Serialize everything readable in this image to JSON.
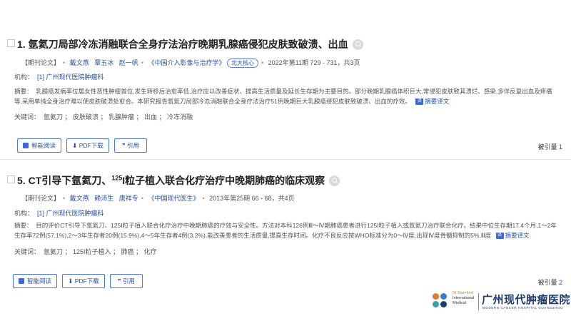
{
  "records": [
    {
      "title_num": "1.",
      "title_text": "氩氦刀局部冷冻消融联合全身疗法治疗晚期乳腺癌侵犯皮肤致破溃、出血",
      "type_label": "【期刊论文】",
      "authors": [
        "戴文燕",
        "覃玉冰",
        "赵一帆"
      ],
      "journal": "《中国介入影像与治疗学》",
      "badge": "北大核心",
      "issue": "2022年第11期 729 - 731，共3页",
      "org_label": "机构：",
      "org_value": "[1] 广州现代医院肿瘤科",
      "abstract_label": "摘要：",
      "abstract": "乳腺癌发病率位居女性恶性肿瘤首位,发生转移后治愈率低,治疗应以改善症状、提高生活质量及延长生存期为主要目的。部分晚期乳腺癌体积巨大,常侵犯皮肤致其溃烂、感染,多伴反复出血及疼痛等,采用单纯全身治疗难以使皮肤破溃处愈合。本研究报告氩氦刀局部冷冻消融联合全身疗法治疗51例晚期巨大乳腺癌侵犯皮肤致破溃、出血的疗效。",
      "translate_label": "摘要译文",
      "keywords_label": "关键词：",
      "keywords": "氩氦刀 ； 皮肤破溃 ； 乳腺肿瘤 ； 出血 ； 冷冻消融",
      "btn_read": "智能阅读",
      "btn_pdf": "PDF下载",
      "btn_cite": "引用",
      "cited_label": "被引量",
      "cited_count": "1"
    },
    {
      "title_num": "5.",
      "title_pre": "CT引导下氩氦刀、",
      "title_sup": "125",
      "title_post": "I粒子植入联合化疗治疗中晚期肺癌的临床观察",
      "type_label": "【期刊论文】",
      "authors": [
        "戴文燕",
        "赖沛生",
        "唐祥专"
      ],
      "journal": "《中国现代医生》",
      "issue": "2013年第25期 66 - 68，共4页",
      "org_label": "机构：",
      "org_value": "[1] 广州现代医院肿瘤科",
      "abstract_label": "摘要：",
      "abstract": "目的评价CT引导下氩氦刀、125I粒子植入联合化疗治疗中晚期肺癌的疗效与安全性。方法对本科126例Ⅲ～Ⅳ期肺癌患者进行125I粒子植入或氩氦刀治疗联合化疗。结果中位生存期17.4个月,1～2年生存率72例(57.1%),2～3年生存者20例(15.9%),4～5年生存者4例(3.2%),能改善患者的生活质量,提高生存时间。化疗不良反应按WHO标准分为0～Ⅳ度,出现Ⅳ度骨髓抑制的5%,Ⅲ度",
      "translate_label": "摘要译文",
      "keywords_label": "关键词：",
      "keywords": "氩氦刀 ； 125I粒子植入 ； 肺癌 ； 化疗",
      "btn_read": "智能阅读",
      "btn_pdf": "PDF下载",
      "btn_cite": "引用",
      "cited_label": "被引量",
      "cited_count": "2"
    }
  ],
  "logo": {
    "en_line1": "St Stamford",
    "en_line2": "International",
    "en_line3": "Medical",
    "cn_name": "广州现代肿瘤医院",
    "en_name": "MODERN CANCER HOSPITAL GUANGZHOU"
  },
  "colors": {
    "link": "#2a50a0",
    "accent": "#3b6bd6"
  }
}
